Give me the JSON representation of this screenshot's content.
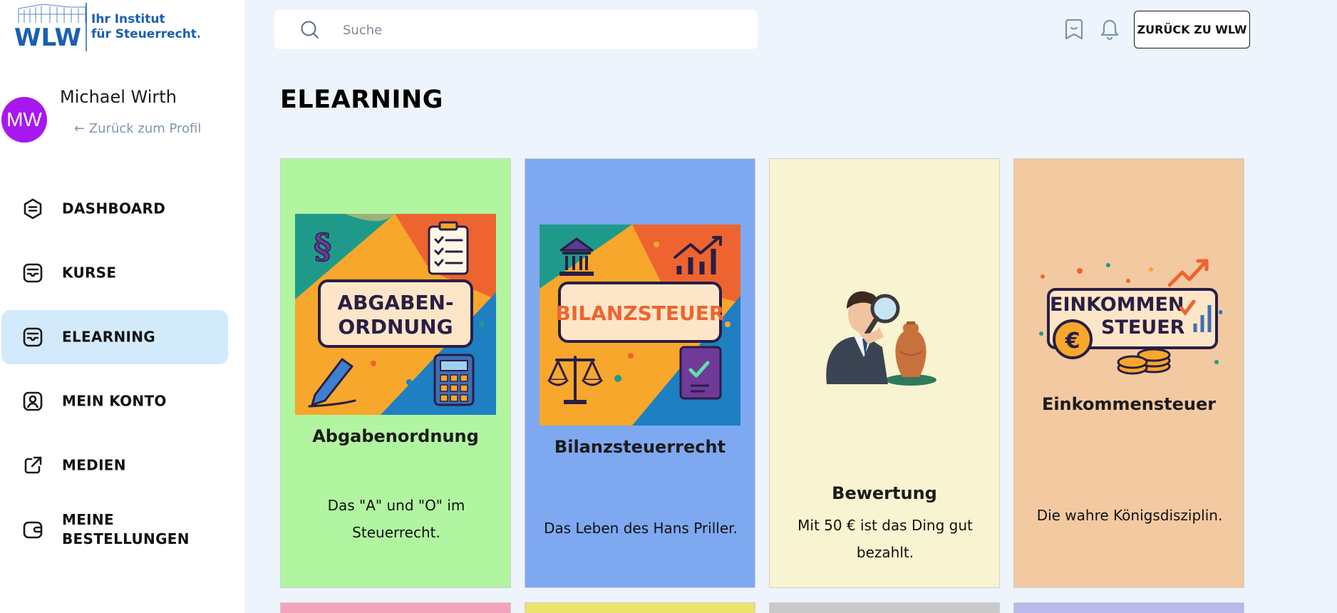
{
  "brand": {
    "letters": "WLW",
    "tagline_line1": "Ihr Institut",
    "tagline_line2": "für Steuerrecht."
  },
  "user": {
    "initials": "MW",
    "name": "Michael Wirth",
    "back_link": "← Zurück zum Profil"
  },
  "nav": {
    "items": [
      {
        "label": "DASHBOARD",
        "icon": "dashboard-icon",
        "active": false
      },
      {
        "label": "KURSE",
        "icon": "courses-icon",
        "active": false
      },
      {
        "label": "ELEARNING",
        "icon": "elearning-icon",
        "active": true
      },
      {
        "label": "MEIN KONTO",
        "icon": "account-icon",
        "active": false
      },
      {
        "label": "MEDIEN",
        "icon": "external-link-icon",
        "active": false
      },
      {
        "label": "MEINE\nBESTELLUNGEN",
        "icon": "wallet-icon",
        "active": false
      }
    ]
  },
  "header": {
    "search_placeholder": "Suche",
    "bookmark_icon": "bookmark-icon",
    "bell_icon": "bell-icon",
    "back_button": "ZURÜCK ZU WLW"
  },
  "page": {
    "title": "ELEARNING"
  },
  "cards": [
    {
      "image_text_1": "ABGABEN-",
      "image_text_2": "ORDNUNG",
      "title": "Abgabenordnung",
      "description": "Das \"A\" und \"O\" im Steuerrecht.",
      "bg": "#b1f5a1"
    },
    {
      "image_text_1": "BILANZSTEUER",
      "title": "Bilanzsteuerrecht",
      "description": "Das Leben des Hans Priller.",
      "bg": "#7ea8f0"
    },
    {
      "title": "Bewertung",
      "description": "Mit 50 € ist das Ding gut bezahlt.",
      "bg": "#f8f3d0"
    },
    {
      "image_text_1": "EINKOMMEN",
      "image_text_2": "STEUER",
      "title": "Einkommensteuer",
      "description": "Die wahre Königsdisziplin.",
      "bg": "#f3c9a1"
    }
  ],
  "next_row_colors": [
    "#f3a4bc",
    "#ece36d",
    "#cacaca",
    "#b9b9ec"
  ],
  "colors": {
    "accent": "#a817f0",
    "active_nav": "#d3eafb",
    "brand_blue": "#1c5fb0"
  }
}
